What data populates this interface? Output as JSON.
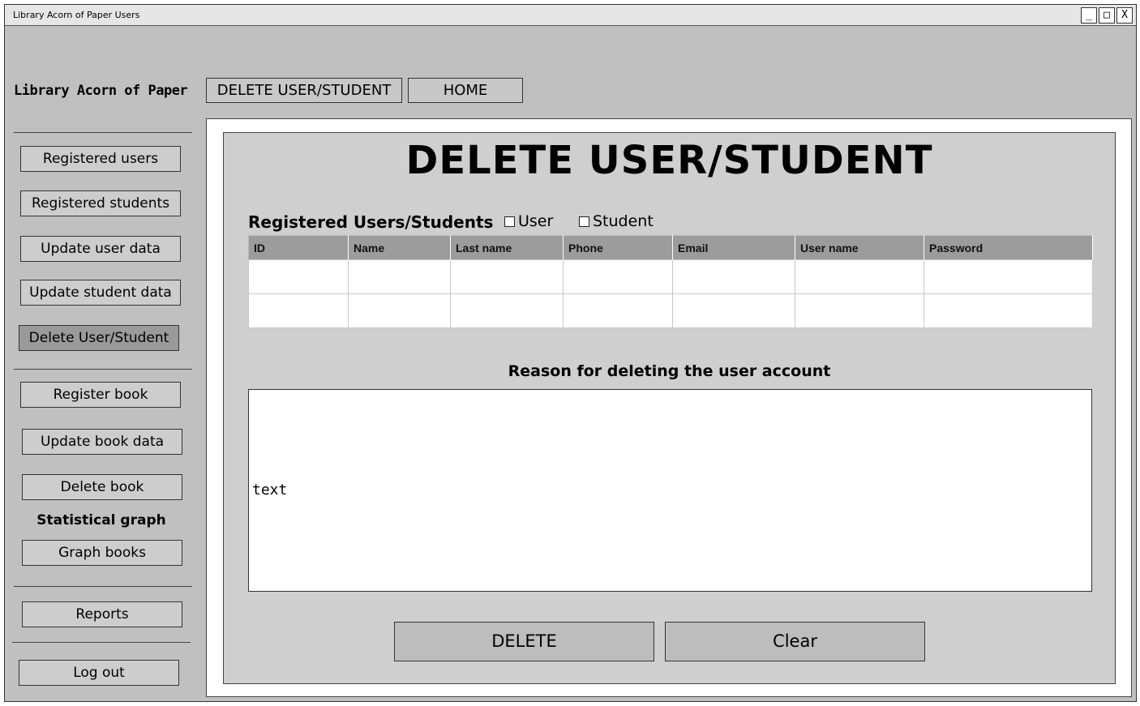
{
  "window": {
    "title": "Library Acorn of Paper Users",
    "controls": [
      "_",
      "□",
      "X"
    ]
  },
  "header": {
    "brand": "Library Acorn of Paper",
    "buttons": [
      "DELETE USER/STUDENT",
      "HOME"
    ]
  },
  "sidebar": {
    "items": [
      {
        "label": "Registered users"
      },
      {
        "label": "Registered students"
      },
      {
        "label": "Update user data"
      },
      {
        "label": "Update student data"
      },
      {
        "label": "Delete User/Student",
        "active": true
      },
      {
        "label": "Register book"
      },
      {
        "label": "Update book data"
      },
      {
        "label": "Delete book"
      },
      {
        "label": "Graph books"
      },
      {
        "label": "Reports"
      },
      {
        "label": "Log out"
      }
    ],
    "section_heading": "Statistical graph"
  },
  "main": {
    "title": "DELETE USER/STUDENT",
    "table_label": "Registered Users/Students",
    "filters": [
      {
        "label": "User",
        "checked": false
      },
      {
        "label": "Student",
        "checked": false
      }
    ],
    "table": {
      "columns": [
        "ID",
        "Name",
        "Last name",
        "Phone",
        "Email",
        "User name",
        "Password"
      ],
      "rows": [
        [
          "",
          "",
          "",
          "",
          "",
          "",
          ""
        ],
        [
          "",
          "",
          "",
          "",
          "",
          "",
          ""
        ]
      ]
    },
    "reason_label": "Reason for deleting the user account",
    "reason_value": "text",
    "actions": {
      "delete_label": "DELETE",
      "clear_label": "Clear"
    }
  },
  "colors": {
    "window_bg": "#c0c0c0",
    "panel_bg": "#cfcfcf",
    "table_header_bg": "#9c9c9c",
    "active_item_bg": "#9a9a9a"
  }
}
